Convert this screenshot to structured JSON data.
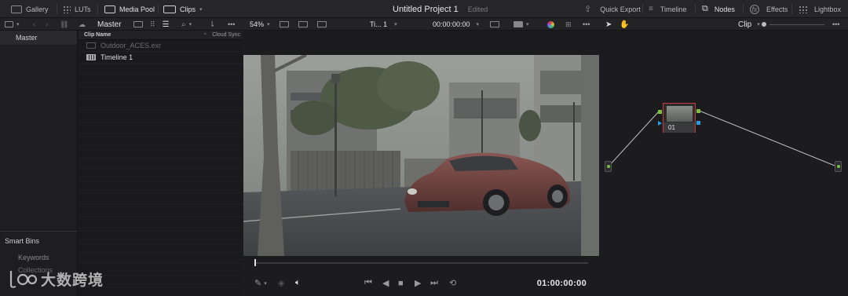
{
  "topbar": {
    "gallery": "Gallery",
    "luts": "LUTs",
    "media_pool": "Media Pool",
    "clips": "Clips",
    "project_title": "Untitled Project 1",
    "project_status": "Edited",
    "quick_export": "Quick Export",
    "timeline": "Timeline",
    "nodes": "Nodes",
    "effects": "Effects",
    "lightbox": "Lightbox"
  },
  "toolbar": {
    "bin_name": "Master",
    "zoom": "54%",
    "timeline_short": "Ti... 1",
    "timecode": "00:00:00:00",
    "clip_mode": "Clip"
  },
  "left_panel": {
    "master": "Master",
    "smart_bins": "Smart Bins",
    "keywords": "Keywords",
    "collections": "Collections"
  },
  "clip_list": {
    "header_name": "Clip Name",
    "header_sync": "Cloud Sync",
    "rows": [
      {
        "name": "Outdoor_ACES.exr",
        "state": "dim"
      },
      {
        "name": "Timeline 1",
        "state": "selected"
      }
    ]
  },
  "viewer": {
    "timecode": "01:00:00:00",
    "playhead_fraction": 0.0
  },
  "node_graph": {
    "node_label": "01"
  },
  "watermark": {
    "text": "大数跨境"
  },
  "colors": {
    "node_border": "#c33a3a",
    "pin_green": "#7ac143",
    "pin_blue": "#2b9be0",
    "car_body": "#6b3f3c"
  },
  "icons": [
    "gallery-icon",
    "luts-icon",
    "media-pool-icon",
    "clips-icon",
    "quick-export-icon",
    "timeline-icon",
    "nodes-icon",
    "effects-icon",
    "lightbox-icon"
  ]
}
